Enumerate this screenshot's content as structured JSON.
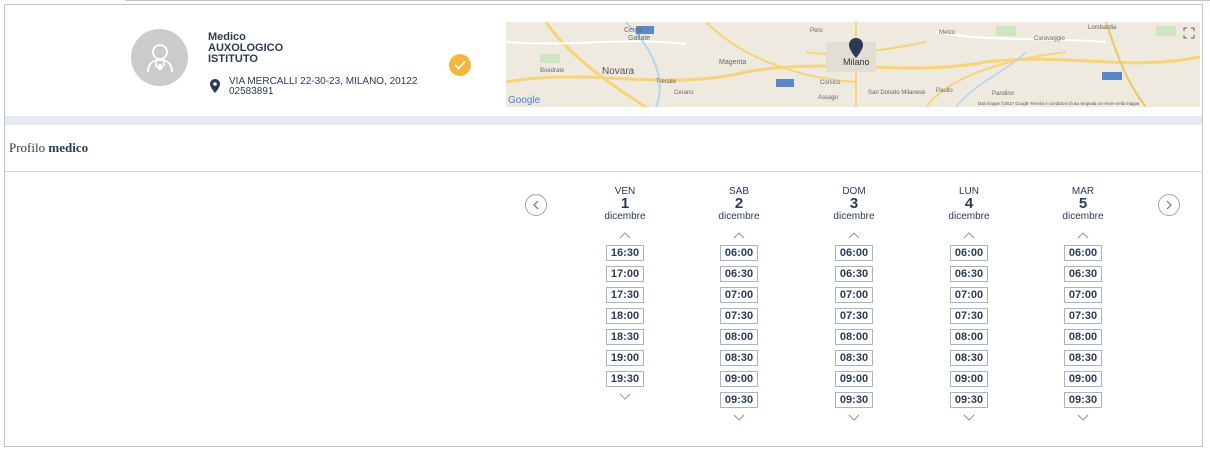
{
  "doctor": {
    "type": "Medico",
    "name_line1": "AUXOLOGICO",
    "name_line2": "ISTITUTO",
    "address": "VIA MERCALLI 22-30-23, MILANO, 20122",
    "phone": "02583891"
  },
  "map": {
    "labels": {
      "cerro": "Cerro",
      "gallate": "Gallate",
      "novara": "Novara",
      "boedrate": "Boedrate",
      "trecate": "Trecate",
      "cerano": "Cerano",
      "magenta": "Magenta",
      "milano": "Milano",
      "corsico": "Corsico",
      "assago": "Assago",
      "san_donato": "San Donato Milanese",
      "paullo": "Paullo",
      "caravaggio": "Caravaggio",
      "lombardia": "Lombardia",
      "pandino": "Pandino",
      "melzo": "Melzo",
      "pero": "Pero",
      "google": "Google",
      "footer": "Dati mappe ©2017 Google   Termini e condizioni d'uso   Segnala un errore nella mappa"
    }
  },
  "profile": {
    "prefix": "Profilo",
    "strong": "medico"
  },
  "calendar": {
    "days": [
      {
        "dow": "VEN",
        "num": "1",
        "month": "dicembre",
        "slots": [
          "16:30",
          "17:00",
          "17:30",
          "18:00",
          "18:30",
          "19:00",
          "19:30"
        ]
      },
      {
        "dow": "SAB",
        "num": "2",
        "month": "dicembre",
        "slots": [
          "06:00",
          "06:30",
          "07:00",
          "07:30",
          "08:00",
          "08:30",
          "09:00",
          "09:30"
        ]
      },
      {
        "dow": "DOM",
        "num": "3",
        "month": "dicembre",
        "slots": [
          "06:00",
          "06:30",
          "07:00",
          "07:30",
          "08:00",
          "08:30",
          "09:00",
          "09:30"
        ]
      },
      {
        "dow": "LUN",
        "num": "4",
        "month": "dicembre",
        "slots": [
          "06:00",
          "06:30",
          "07:00",
          "07:30",
          "08:00",
          "08:30",
          "09:00",
          "09:30"
        ]
      },
      {
        "dow": "MAR",
        "num": "5",
        "month": "dicembre",
        "slots": [
          "06:00",
          "06:30",
          "07:00",
          "07:30",
          "08:00",
          "08:30",
          "09:00",
          "09:30"
        ]
      }
    ]
  },
  "icons": {
    "avatar": "doctor-avatar-icon",
    "pin": "map-pin-icon",
    "verified": "check-icon",
    "prev": "chevron-left-icon",
    "next": "chevron-right-icon",
    "up": "chevron-up-icon",
    "down": "chevron-down-icon"
  },
  "colors": {
    "accent": "#f4b63f",
    "text": "#2b3a55",
    "band": "#e6ebf1"
  }
}
